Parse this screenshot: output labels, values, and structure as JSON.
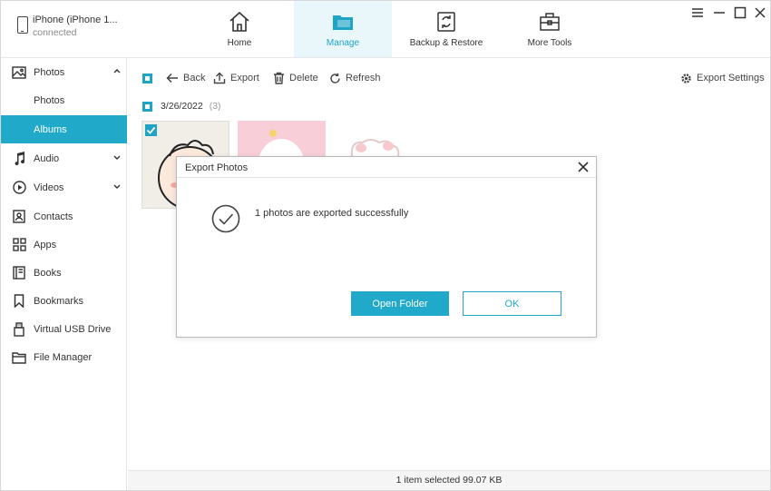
{
  "device": {
    "name": "iPhone (iPhone 1...",
    "status": "connected"
  },
  "nav": {
    "tabs": [
      {
        "label": "Home",
        "icon": "home-icon"
      },
      {
        "label": "Manage",
        "icon": "folder-icon",
        "active": true
      },
      {
        "label": "Backup & Restore",
        "icon": "backup-restore-icon"
      },
      {
        "label": "More Tools",
        "icon": "toolbox-icon"
      }
    ]
  },
  "sidebar": {
    "items": [
      {
        "label": "Photos",
        "icon": "photo-icon",
        "expanded": true
      },
      {
        "label": "Photos",
        "sub": true
      },
      {
        "label": "Albums",
        "sub": true,
        "active": true
      },
      {
        "label": "Audio",
        "icon": "music-icon"
      },
      {
        "label": "Videos",
        "icon": "play-icon"
      },
      {
        "label": "Contacts",
        "icon": "contacts-icon"
      },
      {
        "label": "Apps",
        "icon": "apps-icon"
      },
      {
        "label": "Books",
        "icon": "book-icon"
      },
      {
        "label": "Bookmarks",
        "icon": "bookmark-icon"
      },
      {
        "label": "Virtual USB Drive",
        "icon": "usb-icon"
      },
      {
        "label": "File Manager",
        "icon": "folder-icon"
      }
    ]
  },
  "toolbar": {
    "back": "Back",
    "export": "Export",
    "delete": "Delete",
    "refresh": "Refresh",
    "export_settings": "Export Settings"
  },
  "group": {
    "date": "3/26/2022",
    "count": "(3)"
  },
  "status": {
    "text": "1 item selected 99.07 KB"
  },
  "dialog": {
    "title": "Export Photos",
    "message": "1 photos are exported successfully",
    "open_folder": "Open Folder",
    "ok": "OK"
  },
  "colors": {
    "accent": "#20a9c9",
    "active_tab_bg": "#e9f6fa"
  }
}
